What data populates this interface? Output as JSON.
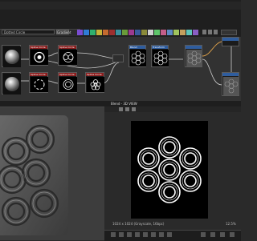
{
  "graph": {
    "search_placeholder": "Dotted Circle",
    "search_button": "Gradient",
    "nodes": [
      {
        "id": "sphere1",
        "title": "Shape"
      },
      {
        "id": "sphere2",
        "title": "Shape"
      },
      {
        "id": "pattern1",
        "title": "Spline Circle"
      },
      {
        "id": "pattern2",
        "title": "Spline Circle"
      },
      {
        "id": "pattern3",
        "title": "Spline Circle"
      },
      {
        "id": "pattern4",
        "title": "Spline Circle"
      },
      {
        "id": "pattern5",
        "title": "Spline Circle"
      },
      {
        "id": "blend",
        "title": "Blend"
      },
      {
        "id": "transform",
        "title": "Transform"
      },
      {
        "id": "output1",
        "title": ""
      },
      {
        "id": "output2",
        "title": ""
      }
    ]
  },
  "viewer": {
    "title": "Blend - 3D VIEW",
    "size_info": "1024 x 1024 (Grayscale, 16bpc)",
    "zoom": "12.5%"
  }
}
